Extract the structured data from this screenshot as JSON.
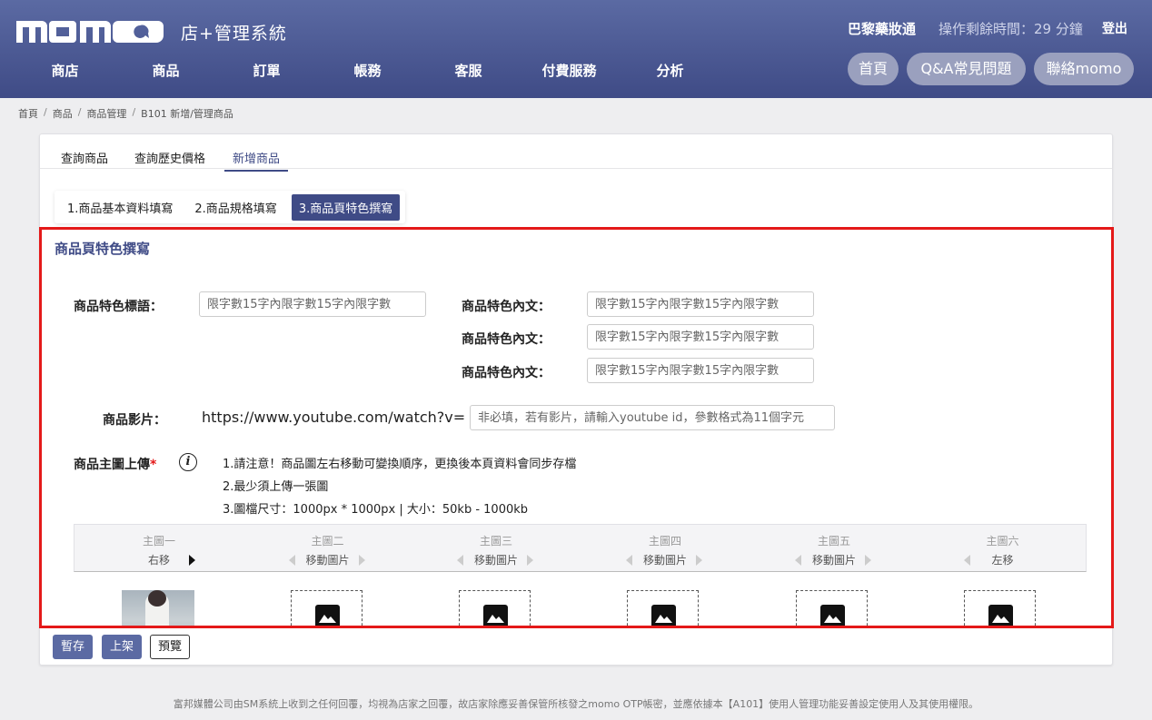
{
  "header": {
    "logo_text": "momo",
    "subtitle": "店+管理系統",
    "store_name": "巴黎藥妝通",
    "timer": "操作剩餘時間：29 分鐘",
    "logout": "登出",
    "nav": [
      "商店",
      "商品",
      "訂單",
      "帳務",
      "客服",
      "付費服務",
      "分析"
    ],
    "pills": [
      "首頁",
      "Q&A常見問題",
      "聯絡momo"
    ]
  },
  "breadcrumb": [
    "首頁",
    "商品",
    "商品管理",
    "B101 新增/管理商品"
  ],
  "tabs": [
    "查詢商品",
    "查詢歷史價格",
    "新增商品"
  ],
  "steps": [
    "1.商品基本資料填寫",
    "2.商品規格填寫",
    "3.商品頁特色撰寫"
  ],
  "section": {
    "title": "商品頁特色撰寫",
    "slogan_label": "商品特色標語：",
    "slogan_placeholder": "限字數15字內限字數15字內限字數",
    "content_label": "商品特色內文：",
    "content_placeholders": [
      "限字數15字內限字數15字內限字數",
      "限字數15字內限字數15字內限字數",
      "限字數15字內限字數15字內限字數"
    ],
    "video_label": "商品影片：",
    "video_prefix": "https://www.youtube.com/watch?v=",
    "video_placeholder": "非必填，若有影片，請輸入youtube id，參數格式為11個字元",
    "upload_label": "商品主圖上傳",
    "upload_required": "*",
    "info_icon": "i",
    "notes": [
      "1.請注意！商品圖左右移動可變換順序，更換後本頁資料會同步存檔",
      "2.最少須上傳一張圖",
      "3.圖檔尺寸：1000px * 1000px | 大小：50kb - 1000kb"
    ]
  },
  "image_grid": {
    "columns": [
      {
        "title": "主圖一",
        "action": "右移"
      },
      {
        "title": "主圖二",
        "action": "移動圖片"
      },
      {
        "title": "主圖三",
        "action": "移動圖片"
      },
      {
        "title": "主圖四",
        "action": "移動圖片"
      },
      {
        "title": "主圖五",
        "action": "移動圖片"
      },
      {
        "title": "主圖六",
        "action": "左移"
      }
    ]
  },
  "buttons": {
    "save": "暫存",
    "publish": "上架",
    "preview": "預覽"
  },
  "footer": "富邦媒體公司由SM系統上收到之任何回覆，均視為店家之回覆，故店家除應妥善保管所核發之momo OTP帳密，並應依據本【A101】使用人管理功能妥善設定使用人及其使用權限。",
  "colors": {
    "brand": "#3f4b86",
    "highlight": "#e41919",
    "required": "#e41919"
  }
}
